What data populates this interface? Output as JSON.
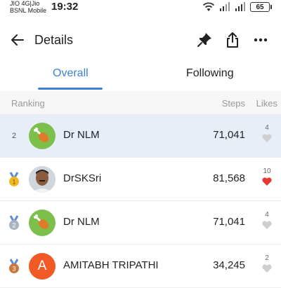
{
  "status_bar": {
    "carrier_line1": "JIO 4G|Jio",
    "carrier_line2": "BSNL Mobile",
    "time": "19:32",
    "battery": "65"
  },
  "app_bar": {
    "title": "Details",
    "icons": [
      "back-arrow-icon",
      "pin-icon",
      "share-icon",
      "more-icon"
    ]
  },
  "tabs": [
    {
      "label": "Overall",
      "selected": true
    },
    {
      "label": "Following",
      "selected": false
    }
  ],
  "table_header": {
    "ranking": "Ranking",
    "steps": "Steps",
    "likes": "Likes"
  },
  "rows": [
    {
      "rank": "2",
      "name": "Dr NLM",
      "steps": "71,041",
      "likes": "4",
      "liked": false,
      "avatar": "drumstick-avatar",
      "medal": null,
      "highlight": true
    },
    {
      "rank": "1",
      "name": "DrSKSri",
      "steps": "81,568",
      "likes": "10",
      "liked": true,
      "avatar": "photo-avatar",
      "medal": "gold"
    },
    {
      "rank": "2",
      "name": "Dr NLM",
      "steps": "71,041",
      "likes": "4",
      "liked": false,
      "avatar": "drumstick-avatar",
      "medal": "silver"
    },
    {
      "rank": "3",
      "name": "AMITABH TRIPATHI",
      "steps": "34,245",
      "likes": "2",
      "liked": false,
      "avatar": "letter-avatar",
      "avatar_letter": "A",
      "medal": "bronze"
    }
  ],
  "colors": {
    "accent": "#3b82d4",
    "highlight_row": "#e8eef8",
    "heart_liked": "#e53935",
    "heart_unliked": "#cfcfcf",
    "avatar_green": "#7cc04b",
    "avatar_orange": "#f15a24",
    "medal_gold": "#f2b822",
    "medal_silver": "#a9b4c2",
    "medal_bronze": "#c9773c"
  }
}
